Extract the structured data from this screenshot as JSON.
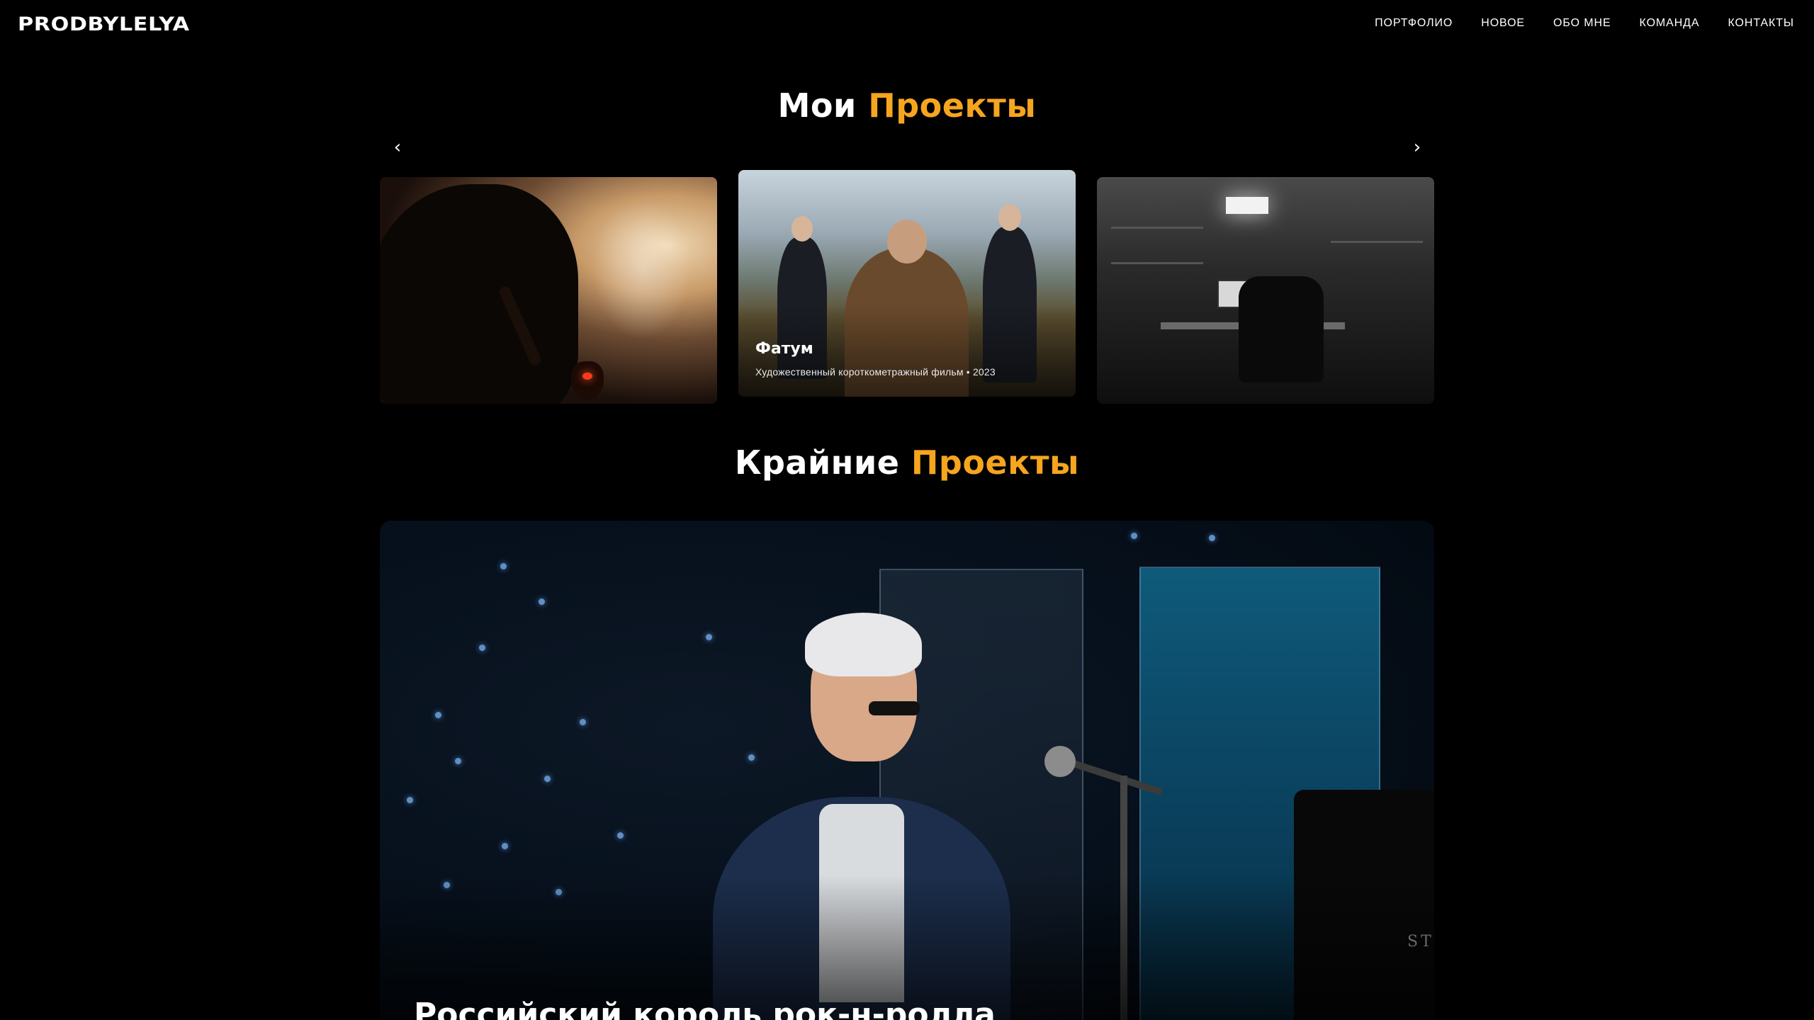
{
  "header": {
    "logo": "PRODBYLELYA",
    "nav": [
      "ПОРТФОЛИО",
      "НОВОЕ",
      "ОБО МНЕ",
      "КОМАНДА",
      "КОНТАКТЫ"
    ]
  },
  "projects": {
    "title_plain": "Мои",
    "title_accent": "Проекты",
    "arrow_prev": "‹",
    "arrow_next": "›",
    "active_card": {
      "title": "Фатум",
      "subtitle": "Художественный короткометражный фильм • 2023"
    }
  },
  "latest": {
    "title_plain": "Крайние",
    "title_accent": "Проекты",
    "featured_title": "Российский король рок-н-ролла",
    "piano_brand": "ST"
  },
  "colors": {
    "accent": "#f6a51e",
    "background": "#000000",
    "text": "#ffffff"
  }
}
